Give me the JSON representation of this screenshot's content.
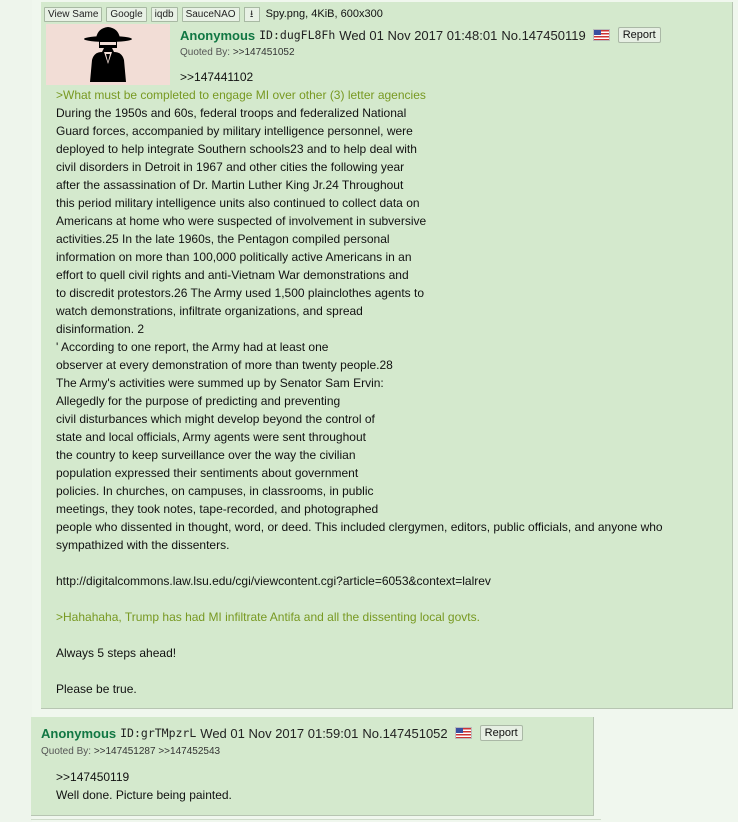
{
  "post1": {
    "file_buttons": [
      "View Same",
      "Google",
      "iqdb",
      "SauceNAO"
    ],
    "file_info": "Spy.png, 4KiB, 600x300",
    "name": "Anonymous",
    "poster_id": "ID:dugFL8Fh",
    "date": "Wed 01 Nov 2017 01:48:01",
    "post_no": "No.147450119",
    "report_label": "Report",
    "quoted_by_label": "Quoted By:",
    "quoted_by_links": [
      ">>147451052"
    ],
    "quotelink": ">>147441102",
    "lines": [
      {
        "text": ">What must be completed to engage MI over other (3) letter agencies",
        "green": true
      },
      {
        "text": "During the 1950s and 60s, federal troops and federalized National"
      },
      {
        "text": "Guard forces, accompanied by military intelligence personnel, were"
      },
      {
        "text": "deployed to help integrate Southern schools23 and to help deal with"
      },
      {
        "text": "civil disorders in Detroit in 1967 and other cities the following year"
      },
      {
        "text": "after the assassination of Dr. Martin Luther King Jr.24 Throughout"
      },
      {
        "text": "this period military intelligence units also continued to collect data on"
      },
      {
        "text": "Americans at home who were suspected of involvement in subversive"
      },
      {
        "text": "activities.25 In the late 1960s, the Pentagon compiled personal"
      },
      {
        "text": "information on more than 100,000 politically active Americans in an"
      },
      {
        "text": "effort to quell civil rights and anti-Vietnam War demonstrations and"
      },
      {
        "text": "to discredit protestors.26 The Army used 1,500 plainclothes agents to"
      },
      {
        "text": "watch demonstrations, infiltrate organizations, and spread"
      },
      {
        "text": "disinformation. 2"
      },
      {
        "text": "' According to one report, the Army had at least one"
      },
      {
        "text": "observer at every demonstration of more than twenty people.28"
      },
      {
        "text": "The Army's activities were summed up by Senator Sam Ervin:"
      },
      {
        "text": "Allegedly for the purpose of predicting and preventing"
      },
      {
        "text": "civil disturbances which might develop beyond the control of"
      },
      {
        "text": "state and local officials, Army agents were sent throughout"
      },
      {
        "text": "the country to keep surveillance over the way the civilian"
      },
      {
        "text": "population expressed their sentiments about government"
      },
      {
        "text": "policies. In churches, on campuses, in classrooms, in public"
      },
      {
        "text": "meetings, they took notes, tape-recorded, and photographed"
      },
      {
        "text": "people who dissented in thought, word, or deed. This included clergymen, editors, public officials, and anyone who"
      },
      {
        "text": "sympathized with the dissenters."
      },
      {
        "text": ""
      },
      {
        "text": "http://digitalcommons.law.lsu.edu/cgi/viewcontent.cgi?article=6053&context=lalrev"
      },
      {
        "text": ""
      },
      {
        "text": ">Hahahaha, Trump has had MI infiltrate Antifa and all the dissenting local govts.",
        "green": true
      },
      {
        "text": ""
      },
      {
        "text": "Always 5 steps ahead!"
      },
      {
        "text": ""
      },
      {
        "text": "Please be true."
      }
    ]
  },
  "post2": {
    "name": "Anonymous",
    "poster_id": "ID:grTMpzrL",
    "date": "Wed 01 Nov 2017 01:59:01",
    "post_no": "No.147451052",
    "report_label": "Report",
    "quoted_by_label": "Quoted By:",
    "quoted_by_links": [
      ">>147451287",
      ">>147452543"
    ],
    "quotelink": ">>147450119",
    "lines": [
      {
        "text": "Well done. Picture being painted."
      }
    ]
  },
  "icons": {
    "download": "download-icon",
    "flag": "us-flag-icon",
    "thumbnail": "spy-silhouette-image"
  },
  "colors": {
    "post_bg": "#d4e9cd",
    "name": "#117743",
    "greentext": "#789922"
  }
}
